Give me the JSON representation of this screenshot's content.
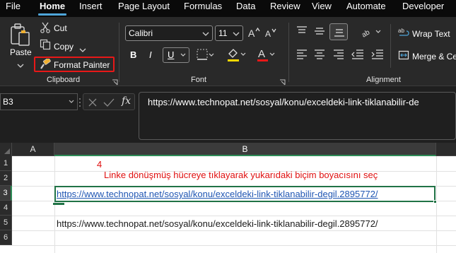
{
  "menu": {
    "items": [
      "File",
      "Home",
      "Insert",
      "Page Layout",
      "Formulas",
      "Data",
      "Review",
      "View",
      "Automate",
      "Developer"
    ],
    "active": "Home"
  },
  "clipboard": {
    "paste_label": "Paste",
    "cut_label": "Cut",
    "copy_label": "Copy",
    "format_painter_label": "Format Painter",
    "group_label": "Clipboard"
  },
  "font": {
    "name": "Calibri",
    "size": "11",
    "group_label": "Font",
    "bold": "B",
    "italic": "I",
    "underline": "U",
    "font_color_glyph": "A",
    "accent_red": "#e81818",
    "highlight_yellow": "#ffd800"
  },
  "alignment": {
    "wrap_text_label": "Wrap Text",
    "merge_label": "Merge & Ce",
    "group_label": "Alignment"
  },
  "formula_bar": {
    "name_box": "B3",
    "fx_label": "fx",
    "formula": "https://www.technopat.net/sosyal/konu/exceldeki-link-tiklanabilir-de"
  },
  "grid": {
    "columns": [
      "A",
      "B"
    ],
    "selected_column": "B",
    "rows": [
      "1",
      "2",
      "3",
      "4",
      "5",
      "6"
    ],
    "selected_row": "3",
    "annotation_number": "4",
    "annotation_text": "Linke dönüşmüş hücreye tıklayarak yukarıdaki biçim boyacısını seç",
    "link_cell": "https://www.technopat.net/sosyal/konu/exceldeki-link-tiklanabilir-degil.2895772/",
    "plain_cell": "https://www.technopat.net/sosyal/konu/exceldeki-link-tiklanabilir-degil.2895772/",
    "active_cell_color": "#217346",
    "link_color": "#1f56b3"
  }
}
